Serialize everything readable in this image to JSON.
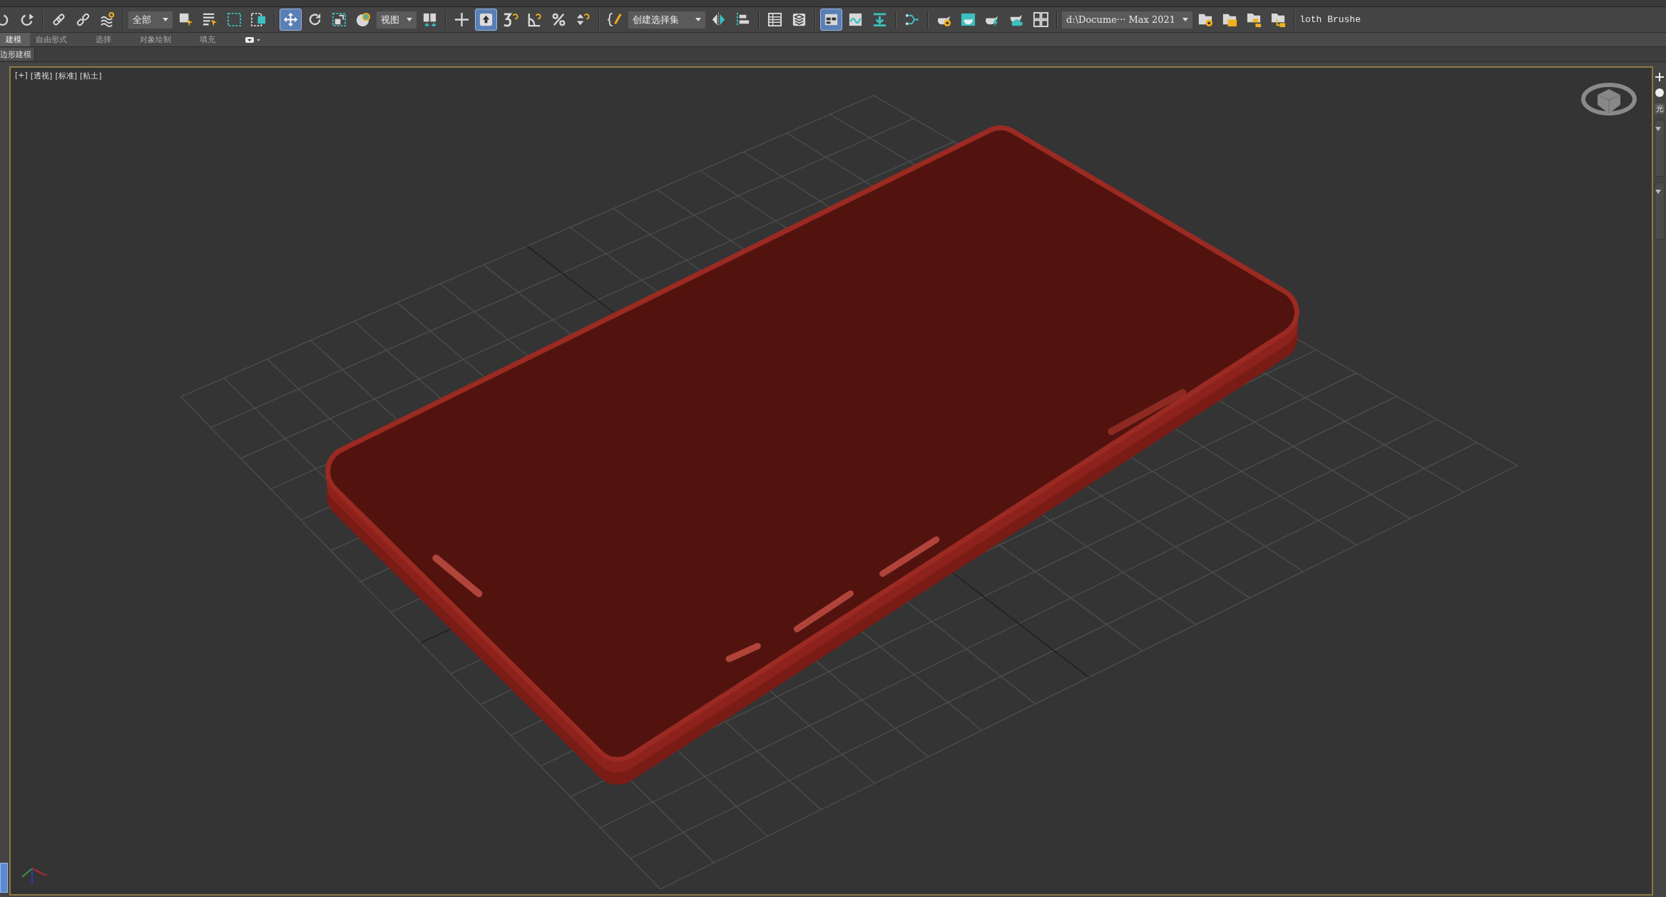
{
  "toolbar": {
    "items": [
      {
        "kind": "button",
        "selected": false
      },
      {
        "kind": "button",
        "selected": false
      },
      {
        "kind": "separator"
      },
      {
        "kind": "button",
        "selected": false
      },
      {
        "kind": "button",
        "selected": false
      },
      {
        "kind": "button",
        "selected": false
      },
      {
        "kind": "separator"
      },
      {
        "kind": "dropdown",
        "value": "全部"
      },
      {
        "kind": "button",
        "selected": false
      },
      {
        "kind": "button",
        "selected": false
      },
      {
        "kind": "button",
        "selected": false
      },
      {
        "kind": "button",
        "selected": false
      },
      {
        "kind": "separator"
      },
      {
        "kind": "button",
        "selected": true
      },
      {
        "kind": "button",
        "selected": false
      },
      {
        "kind": "button",
        "selected": false
      },
      {
        "kind": "button",
        "selected": false
      },
      {
        "kind": "dropdown",
        "value": "视图"
      },
      {
        "kind": "button",
        "selected": false
      },
      {
        "kind": "separator"
      },
      {
        "kind": "button",
        "selected": false
      },
      {
        "kind": "button",
        "selected": true
      },
      {
        "kind": "button",
        "selected": false
      },
      {
        "kind": "button",
        "selected": false
      },
      {
        "kind": "button",
        "selected": false
      },
      {
        "kind": "button",
        "selected": false
      },
      {
        "kind": "separator"
      },
      {
        "kind": "button",
        "selected": false
      },
      {
        "kind": "dropdown",
        "value": "创建选择集"
      },
      {
        "kind": "button",
        "selected": false
      },
      {
        "kind": "button",
        "selected": false
      },
      {
        "kind": "separator"
      },
      {
        "kind": "button",
        "selected": false
      },
      {
        "kind": "button",
        "selected": false
      },
      {
        "kind": "separator"
      },
      {
        "kind": "button",
        "selected": true
      },
      {
        "kind": "button",
        "selected": false
      },
      {
        "kind": "button",
        "selected": false
      },
      {
        "kind": "separator"
      },
      {
        "kind": "button",
        "selected": false
      },
      {
        "kind": "separator"
      },
      {
        "kind": "button",
        "selected": false
      },
      {
        "kind": "button",
        "selected": false
      },
      {
        "kind": "button",
        "selected": false
      },
      {
        "kind": "button",
        "selected": false
      },
      {
        "kind": "button",
        "selected": false
      },
      {
        "kind": "separator"
      },
      {
        "kind": "dropdown",
        "value": "d:\\Docume··· Max 2021"
      },
      {
        "kind": "button",
        "selected": false
      },
      {
        "kind": "button",
        "selected": false
      },
      {
        "kind": "button",
        "selected": false
      },
      {
        "kind": "button",
        "selected": false
      },
      {
        "kind": "separator"
      },
      {
        "kind": "label",
        "text": "loth Brushe"
      }
    ]
  },
  "ribbon": {
    "tabs": [
      {
        "label": "建模",
        "selected": true
      },
      {
        "label": "自由形式",
        "selected": false
      },
      {
        "label": "选择",
        "selected": false
      },
      {
        "label": "对象绘制",
        "selected": false
      },
      {
        "label": "填充",
        "selected": false
      }
    ]
  },
  "ribbon_panel": {
    "title": "边形建模"
  },
  "viewport": {
    "labels": [
      "[+]",
      "[透视]",
      "[标准]",
      "[粘土]"
    ]
  },
  "command_panel": {
    "tab_label": "光"
  }
}
